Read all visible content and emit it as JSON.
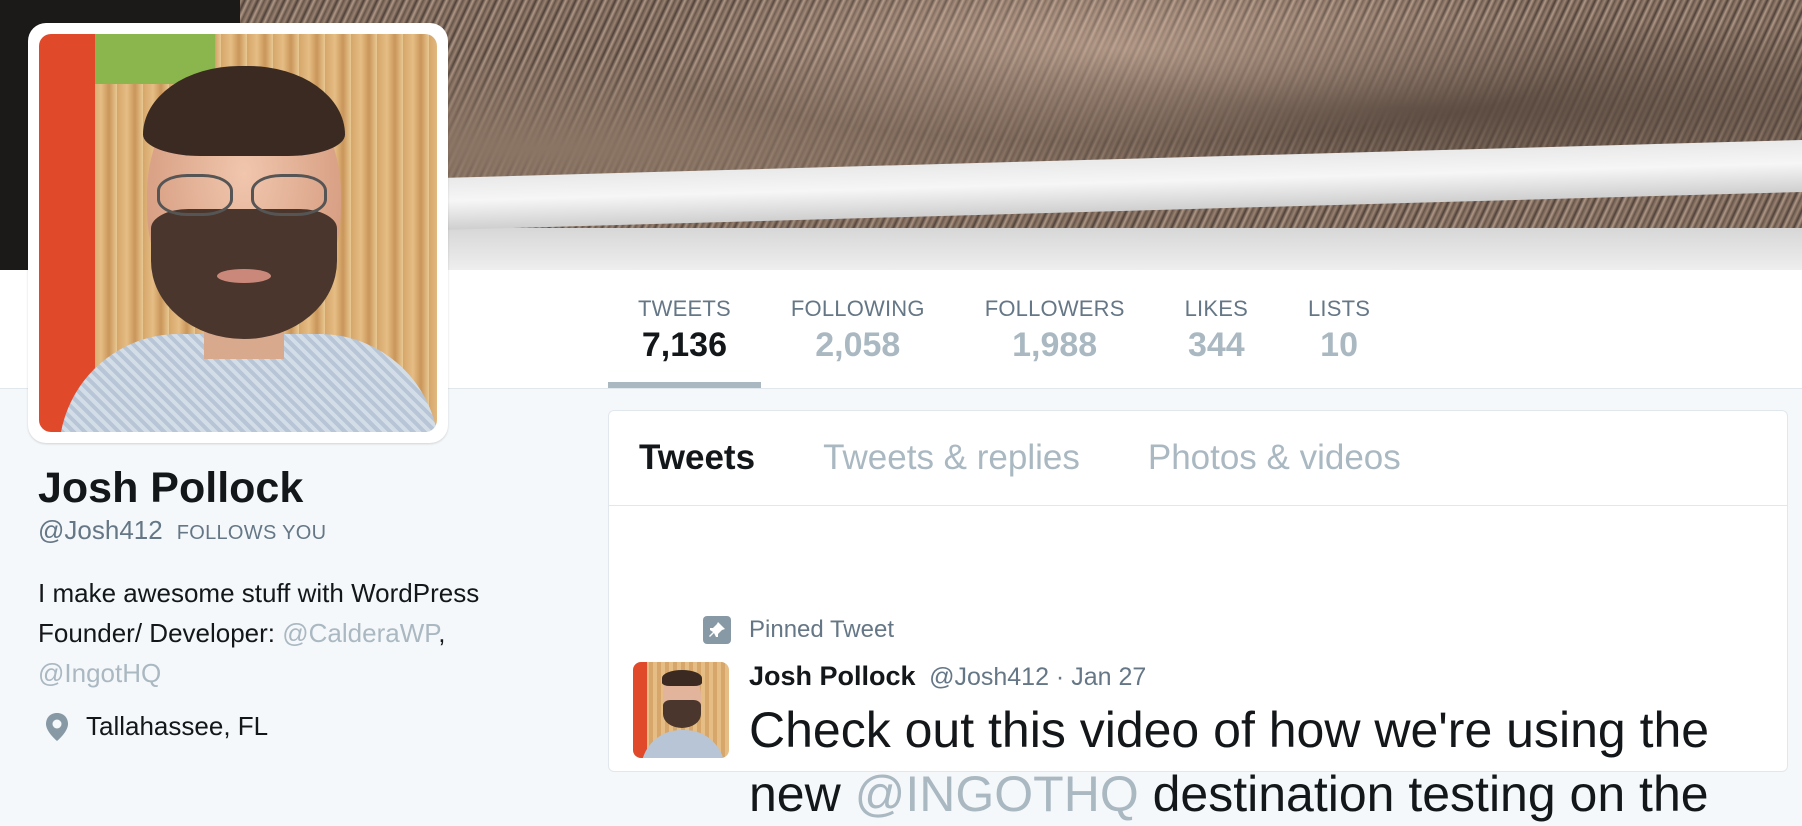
{
  "profile": {
    "name": "Josh Pollock",
    "handle": "@Josh412",
    "follows_you": "FOLLOWS YOU",
    "bio_line1": "I make awesome stuff with WordPress",
    "bio_line2_prefix": "Founder/ Developer: ",
    "bio_mention1": "@CalderaWP",
    "bio_sep": ",",
    "bio_mention2": "@IngotHQ",
    "location": "Tallahassee, FL"
  },
  "stats": [
    {
      "label": "TWEETS",
      "value": "7,136"
    },
    {
      "label": "FOLLOWING",
      "value": "2,058"
    },
    {
      "label": "FOLLOWERS",
      "value": "1,988"
    },
    {
      "label": "LIKES",
      "value": "344"
    },
    {
      "label": "LISTS",
      "value": "10"
    }
  ],
  "tabs": [
    {
      "label": "Tweets"
    },
    {
      "label": "Tweets & replies"
    },
    {
      "label": "Photos & videos"
    }
  ],
  "pinned_tweet": {
    "pinned_label": "Pinned Tweet",
    "author": "Josh Pollock",
    "meta": "@Josh412 · Jan 27",
    "text_part1": "Check out this video of how we're using the new ",
    "text_mention": "@INGOTHQ",
    "text_part2": " destination testing on the"
  },
  "colors": {
    "accent_muted": "#aab8c2",
    "secondary_text": "#657786",
    "primary_text": "#14171a"
  }
}
